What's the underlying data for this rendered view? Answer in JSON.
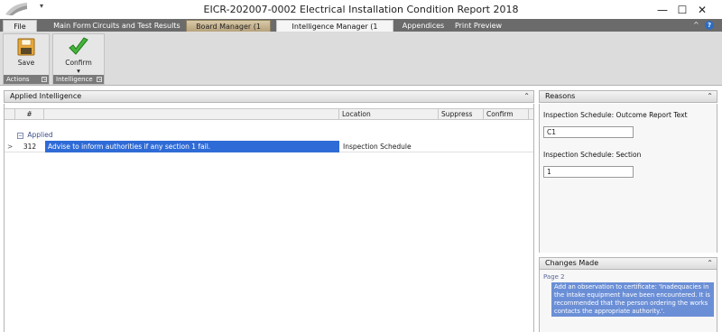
{
  "window": {
    "title": "EICR-202007-0002 Electrical Installation Condition Report 2018",
    "minimize": "—",
    "maximize": "☐",
    "close": "✕"
  },
  "qat": {
    "dropdown": "▾"
  },
  "tabs": [
    {
      "label": "File"
    },
    {
      "label": "Main Form"
    },
    {
      "label": "Circuits and Test Results"
    },
    {
      "label": "Board Manager (1 Board)"
    },
    {
      "label": "Intelligence Manager (1 Statement)"
    },
    {
      "label": "Appendices"
    },
    {
      "label": "Print Preview"
    }
  ],
  "tabstrip": {
    "collapse": "^",
    "help": "?"
  },
  "ribbon": {
    "groups": [
      {
        "label": "Actions",
        "button": "Save",
        "icon": "save-icon"
      },
      {
        "label": "Intelligence",
        "button": "Confirm",
        "icon": "checkmark-icon",
        "dropdown": "▾"
      }
    ],
    "launcher": "↘"
  },
  "applied_panel": {
    "title": "Applied Intelligence",
    "collapse": "⌃",
    "columns": [
      "#",
      "",
      "Location",
      "Suppress",
      "Confirm"
    ],
    "group_label": "Applied",
    "group_toggle": "−",
    "rows": [
      {
        "indicator": ">",
        "num": "312",
        "text": "Advise to inform authorities if any section 1 fail.",
        "location": "Inspection Schedule",
        "suppress": "",
        "confirm": ""
      }
    ]
  },
  "reasons_panel": {
    "title": "Reasons",
    "collapse": "⌃",
    "fields": [
      {
        "label": "Inspection Schedule: Outcome Report Text",
        "value": "C1"
      },
      {
        "label": "Inspection Schedule: Section",
        "value": "1"
      }
    ]
  },
  "changes_panel": {
    "title": "Changes Made",
    "collapse": "⌃",
    "page": "Page 2",
    "change": "Add an observation to certificate: 'Inadequacies in the intake equipment have been encountered.  It is recommended that the person ordering the works contacts the appropriate authority.'."
  },
  "colors": {
    "tabstrip": "#6b6b6b",
    "selection": "#2f6bd6",
    "change_highlight": "#6b8fd6"
  }
}
